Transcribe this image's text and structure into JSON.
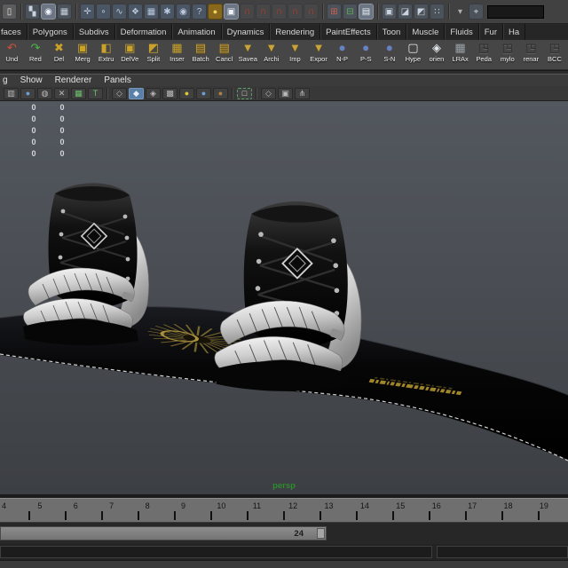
{
  "colors": {
    "toolbar_bg": "#414141",
    "tab_bg": "#262626",
    "shelf_bg": "#464646",
    "panel_bg": "#3b3b3b",
    "vp_top": "#53575e",
    "vp_bottom": "#3c3f43",
    "timeline_bg": "#6f6f6f",
    "persp_green": "#2e8b2e",
    "gold": "#c9a227",
    "magnet_red": "#c0392b",
    "active_blue": "#5a80a8",
    "board_black": "#070707",
    "boot_white": "#e8e8e8",
    "logo_gold": "#8a7630"
  },
  "status_line": {
    "icons": [
      {
        "name": "file-new-icon",
        "glyph": "▯"
      },
      {
        "name": "select-hierarchy-icon",
        "glyph": "▚"
      },
      {
        "name": "select-object-icon",
        "glyph": "◉"
      },
      {
        "name": "select-component-icon",
        "glyph": "▦"
      },
      {
        "name": "mask-points-icon",
        "glyph": "✛"
      },
      {
        "name": "mask-handles-icon",
        "glyph": "∘"
      },
      {
        "name": "mask-curves-icon",
        "glyph": "∿"
      },
      {
        "name": "mask-surfaces-icon",
        "glyph": "❖"
      },
      {
        "name": "mask-deformations-icon",
        "glyph": "▦"
      },
      {
        "name": "mask-dynamics-icon",
        "glyph": "✱"
      },
      {
        "name": "mask-rendering-icon",
        "glyph": "◉"
      },
      {
        "name": "mask-misc-icon",
        "glyph": "?"
      },
      {
        "name": "lock-icon",
        "glyph": "●"
      },
      {
        "name": "highlight-mode-icon",
        "glyph": "▣"
      },
      {
        "name": "snap-grid-icon",
        "glyph": "∩"
      },
      {
        "name": "snap-curve-icon",
        "glyph": "∩"
      },
      {
        "name": "snap-point-icon",
        "glyph": "∩"
      },
      {
        "name": "snap-plane-icon",
        "glyph": "∩"
      },
      {
        "name": "snap-live-icon",
        "glyph": "∩"
      },
      {
        "name": "input-connections-icon",
        "glyph": "⊞"
      },
      {
        "name": "output-connections-icon",
        "glyph": "⊟"
      },
      {
        "name": "history-icon",
        "glyph": "▤"
      },
      {
        "name": "render-view-icon",
        "glyph": "▣"
      },
      {
        "name": "render-frame-icon",
        "glyph": "◪"
      },
      {
        "name": "ipr-render-icon",
        "glyph": "◩"
      },
      {
        "name": "render-settings-icon",
        "glyph": "∷"
      },
      {
        "name": "dropdown-chevron-icon",
        "glyph": "▾"
      },
      {
        "name": "quick-select-icon",
        "glyph": "⌖"
      }
    ]
  },
  "shelf_tabs": {
    "items": [
      "faces",
      "Polygons",
      "Subdivs",
      "Deformation",
      "Animation",
      "Dynamics",
      "Rendering",
      "PaintEffects",
      "Toon",
      "Muscle",
      "Fluids",
      "Fur",
      "Ha"
    ]
  },
  "shelf": {
    "buttons": [
      {
        "label": "Und",
        "glyph": "↶"
      },
      {
        "label": "Red",
        "glyph": "↷"
      },
      {
        "label": "Del",
        "glyph": "✖"
      },
      {
        "label": "Merg",
        "glyph": "▣"
      },
      {
        "label": "Extru",
        "glyph": "◧"
      },
      {
        "label": "DelVe",
        "glyph": "▣"
      },
      {
        "label": "Split",
        "glyph": "◩"
      },
      {
        "label": "Inser",
        "glyph": "▦"
      },
      {
        "label": "Batch",
        "glyph": "▤"
      },
      {
        "label": "Cancl",
        "glyph": "▤"
      },
      {
        "label": "Savea",
        "glyph": "▼"
      },
      {
        "label": "Archi",
        "glyph": "▼"
      },
      {
        "label": "Imp",
        "glyph": "▼"
      },
      {
        "label": "Expor",
        "glyph": "▼"
      },
      {
        "label": "N-P",
        "glyph": "●"
      },
      {
        "label": "P-S",
        "glyph": "●"
      },
      {
        "label": "S-N",
        "glyph": "●"
      },
      {
        "label": "Hype",
        "glyph": "▢"
      },
      {
        "label": "orien",
        "glyph": "◈"
      },
      {
        "label": "LRAx",
        "glyph": "▦"
      },
      {
        "label": "Peda",
        "glyph": "◳"
      },
      {
        "label": "mylo",
        "glyph": "◳"
      },
      {
        "label": "renar",
        "glyph": "◳"
      },
      {
        "label": "BCC",
        "glyph": "◳"
      }
    ]
  },
  "panel_menu": {
    "items": [
      "g",
      "Show",
      "Renderer",
      "Panels"
    ]
  },
  "vp_toolbar": {
    "icons": [
      {
        "name": "film-gate-icon",
        "glyph": "▥"
      },
      {
        "name": "resolution-gate-icon",
        "glyph": "●"
      },
      {
        "name": "gate-mask-icon",
        "glyph": "◍"
      },
      {
        "name": "field-chart-icon",
        "glyph": "✕"
      },
      {
        "name": "safe-action-icon",
        "glyph": "▦"
      },
      {
        "name": "safe-title-icon",
        "glyph": "T"
      },
      {
        "name": "wireframe-icon",
        "glyph": "◇"
      },
      {
        "name": "shaded-icon",
        "glyph": "◆"
      },
      {
        "name": "textured-icon",
        "glyph": "◈"
      },
      {
        "name": "checker-icon",
        "glyph": "▩"
      },
      {
        "name": "default-light-icon",
        "glyph": "●"
      },
      {
        "name": "all-lights-icon",
        "glyph": "●"
      },
      {
        "name": "shadows-icon",
        "glyph": "●"
      },
      {
        "name": "select-cursor-icon",
        "glyph": "□"
      },
      {
        "name": "isolate-select-icon",
        "glyph": "◇"
      },
      {
        "name": "frame-selection-icon",
        "glyph": "▣"
      },
      {
        "name": "graph-connections-icon",
        "glyph": "⋔"
      }
    ]
  },
  "viewport": {
    "camera_label": "persp",
    "hud": {
      "rows": [
        [
          "0",
          "0"
        ],
        [
          "0",
          "0"
        ],
        [
          "0",
          "0"
        ],
        [
          "0",
          "0"
        ],
        [
          "0",
          "0"
        ]
      ]
    }
  },
  "timeline": {
    "frames": [
      "4",
      "5",
      "6",
      "7",
      "8",
      "9",
      "10",
      "11",
      "12",
      "13",
      "14",
      "15",
      "16",
      "17",
      "18",
      "19"
    ]
  },
  "range_slider": {
    "end_frame": "24"
  }
}
